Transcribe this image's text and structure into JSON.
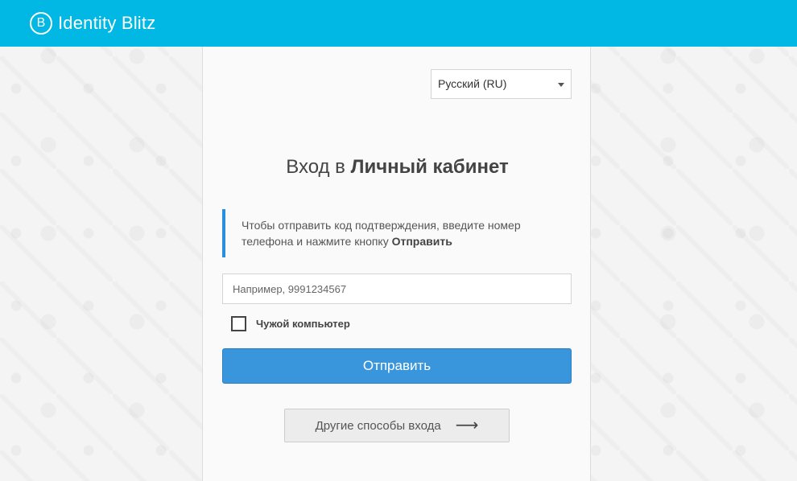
{
  "header": {
    "logo_letter": "B",
    "brand_name": "Identity Blitz",
    "bar_color": "#00b8e3"
  },
  "language": {
    "selected": "Русский (RU)"
  },
  "title": {
    "prefix": "Вход в ",
    "bold": "Личный кабинет"
  },
  "notice": {
    "text_line1": "Чтобы отправить код подтверждения, введите номер",
    "text_line2": "телефона и нажмите кнопку ",
    "text_bold": "Отправить",
    "accent_color": "#2b8fe0"
  },
  "phone": {
    "placeholder": "Например, 9991234567",
    "value": ""
  },
  "checkbox": {
    "label": "Чужой компьютер",
    "checked": false
  },
  "submit": {
    "label": "Отправить",
    "color": "#3a96dc"
  },
  "other": {
    "label": "Другие способы входа",
    "icon": "arrow-right-icon"
  }
}
